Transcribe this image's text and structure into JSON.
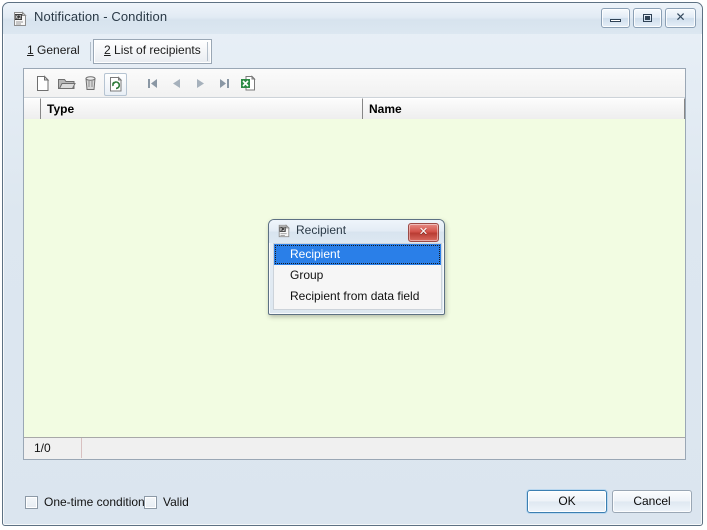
{
  "window": {
    "title": "Notification - Condition",
    "icon": "k2-document-icon",
    "controls": [
      {
        "name": "minimize",
        "glyph": "minimize-icon"
      },
      {
        "name": "maximize",
        "glyph": "maximize-icon"
      },
      {
        "name": "close",
        "glyph": "close-icon"
      }
    ],
    "close_glyph": "✕"
  },
  "tabs": [
    {
      "accel": "1",
      "label": " General",
      "selected": false
    },
    {
      "accel": "2",
      "label": " List of recipients",
      "selected": true
    }
  ],
  "toolbar": {
    "buttons": [
      {
        "name": "new-document",
        "icon": "new-document-icon",
        "tooltip": "New"
      },
      {
        "name": "open-folder",
        "icon": "open-folder-icon",
        "tooltip": "Open"
      },
      {
        "name": "delete-trash",
        "icon": "trash-bin-icon",
        "tooltip": "Delete"
      },
      {
        "name": "refresh-document",
        "icon": "refresh-document-icon",
        "tooltip": "Refresh"
      },
      {
        "name": "first-record",
        "icon": "first-record-icon",
        "tooltip": "First"
      },
      {
        "name": "previous-record",
        "icon": "previous-record-icon",
        "tooltip": "Previous"
      },
      {
        "name": "next-record",
        "icon": "next-record-icon",
        "tooltip": "Next"
      },
      {
        "name": "last-record",
        "icon": "last-record-icon",
        "tooltip": "Last"
      },
      {
        "name": "export-excel",
        "icon": "excel-export-icon",
        "tooltip": "Export to Excel"
      }
    ]
  },
  "grid": {
    "columns": [
      {
        "label": "Type"
      },
      {
        "label": "Name"
      }
    ],
    "rows": [],
    "status": "1/0"
  },
  "footer": {
    "checkboxes": [
      {
        "label": "One-time condition",
        "checked": false
      },
      {
        "label": "Valid",
        "checked": false
      }
    ],
    "ok_label": "OK",
    "cancel_label": "Cancel"
  },
  "popup": {
    "title": "Recipient",
    "icon": "k2-document-icon",
    "close_glyph": "✕",
    "items": [
      {
        "label": "Recipient",
        "selected": true
      },
      {
        "label": "Group",
        "selected": false
      },
      {
        "label": "Recipient from data field",
        "selected": false
      }
    ]
  },
  "colors": {
    "grid_background": "#f2fce2",
    "selection": "#2a7fe8",
    "frame": "#5d7183",
    "accent_close": "#b93c33"
  }
}
